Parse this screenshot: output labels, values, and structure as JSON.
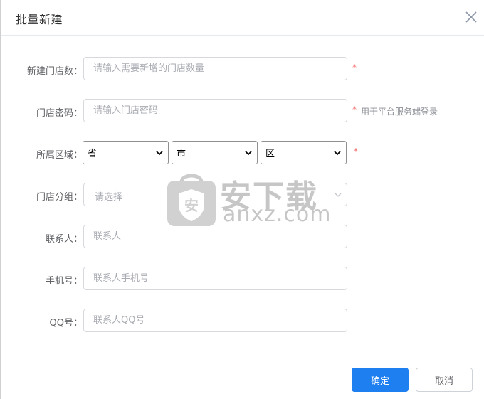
{
  "dialog": {
    "title": "批量新建",
    "close_icon": "close-icon"
  },
  "form": {
    "store_count": {
      "label": "新建门店数：",
      "placeholder": "请输入需要新增的门店数量",
      "required_mark": "*"
    },
    "store_password": {
      "label": "门店密码：",
      "placeholder": "请输入门店密码",
      "required_mark": "*",
      "hint": "用于平台服务端登录"
    },
    "region": {
      "label": "所属区域：",
      "province": "省",
      "city": "市",
      "district": "区",
      "required_mark": "*",
      "chevron_icon": "chevron-down-icon"
    },
    "store_group": {
      "label": "门店分组：",
      "placeholder": "请选择",
      "chevron_icon": "chevron-down-icon"
    },
    "contact": {
      "label": "联系人：",
      "placeholder": "联系人"
    },
    "phone": {
      "label": "手机号：",
      "placeholder": "联系人手机号"
    },
    "qq": {
      "label": "QQ号：",
      "placeholder": "联系人QQ号"
    }
  },
  "footer": {
    "confirm_label": "确定",
    "cancel_label": "取消"
  },
  "watermark": {
    "cn": "安下载",
    "en": "anxz.com",
    "shield_char": "安"
  },
  "colors": {
    "primary": "#1e7ff0",
    "required": "#f56c6c",
    "placeholder": "#a8abb2",
    "label": "#606266"
  }
}
